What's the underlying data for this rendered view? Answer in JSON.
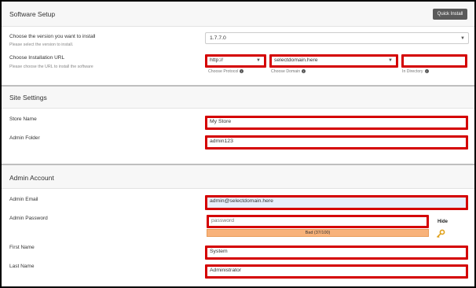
{
  "software_setup": {
    "title": "Software Setup",
    "quick_install_label": "Quick Install",
    "version": {
      "label": "Choose the version you want to install",
      "help": "Please select the version to install.",
      "value": "1.7.7.0"
    },
    "url": {
      "label": "Choose Installation URL",
      "help": "Please choose the URL to install the software",
      "protocol_value": "http://",
      "protocol_label": "Choose Protocol",
      "domain_value": "selectdomain.here",
      "domain_label": "Choose Domain",
      "directory_value": "",
      "directory_label": "In Directory"
    }
  },
  "site_settings": {
    "title": "Site Settings",
    "store_name": {
      "label": "Store Name",
      "value": "My Store"
    },
    "admin_folder": {
      "label": "Admin Folder",
      "value": "admin123"
    }
  },
  "admin_account": {
    "title": "Admin Account",
    "email": {
      "label": "Admin Email",
      "value": "admin@selectdomain.here"
    },
    "password": {
      "label": "Admin Password",
      "value": "password",
      "hide_label": "Hide",
      "strength_text": "Bad (37/100)",
      "strength_percent": 37
    },
    "first_name": {
      "label": "First Name",
      "value": "System"
    },
    "last_name": {
      "label": "Last Name",
      "value": "Administrator"
    }
  },
  "colors": {
    "highlight_border": "#d40000",
    "strength_bar": "#f8b27a",
    "quick_install_bg": "#5a5a5a"
  },
  "icons": [
    "info-icon",
    "chevron-down-icon",
    "key-icon"
  ]
}
